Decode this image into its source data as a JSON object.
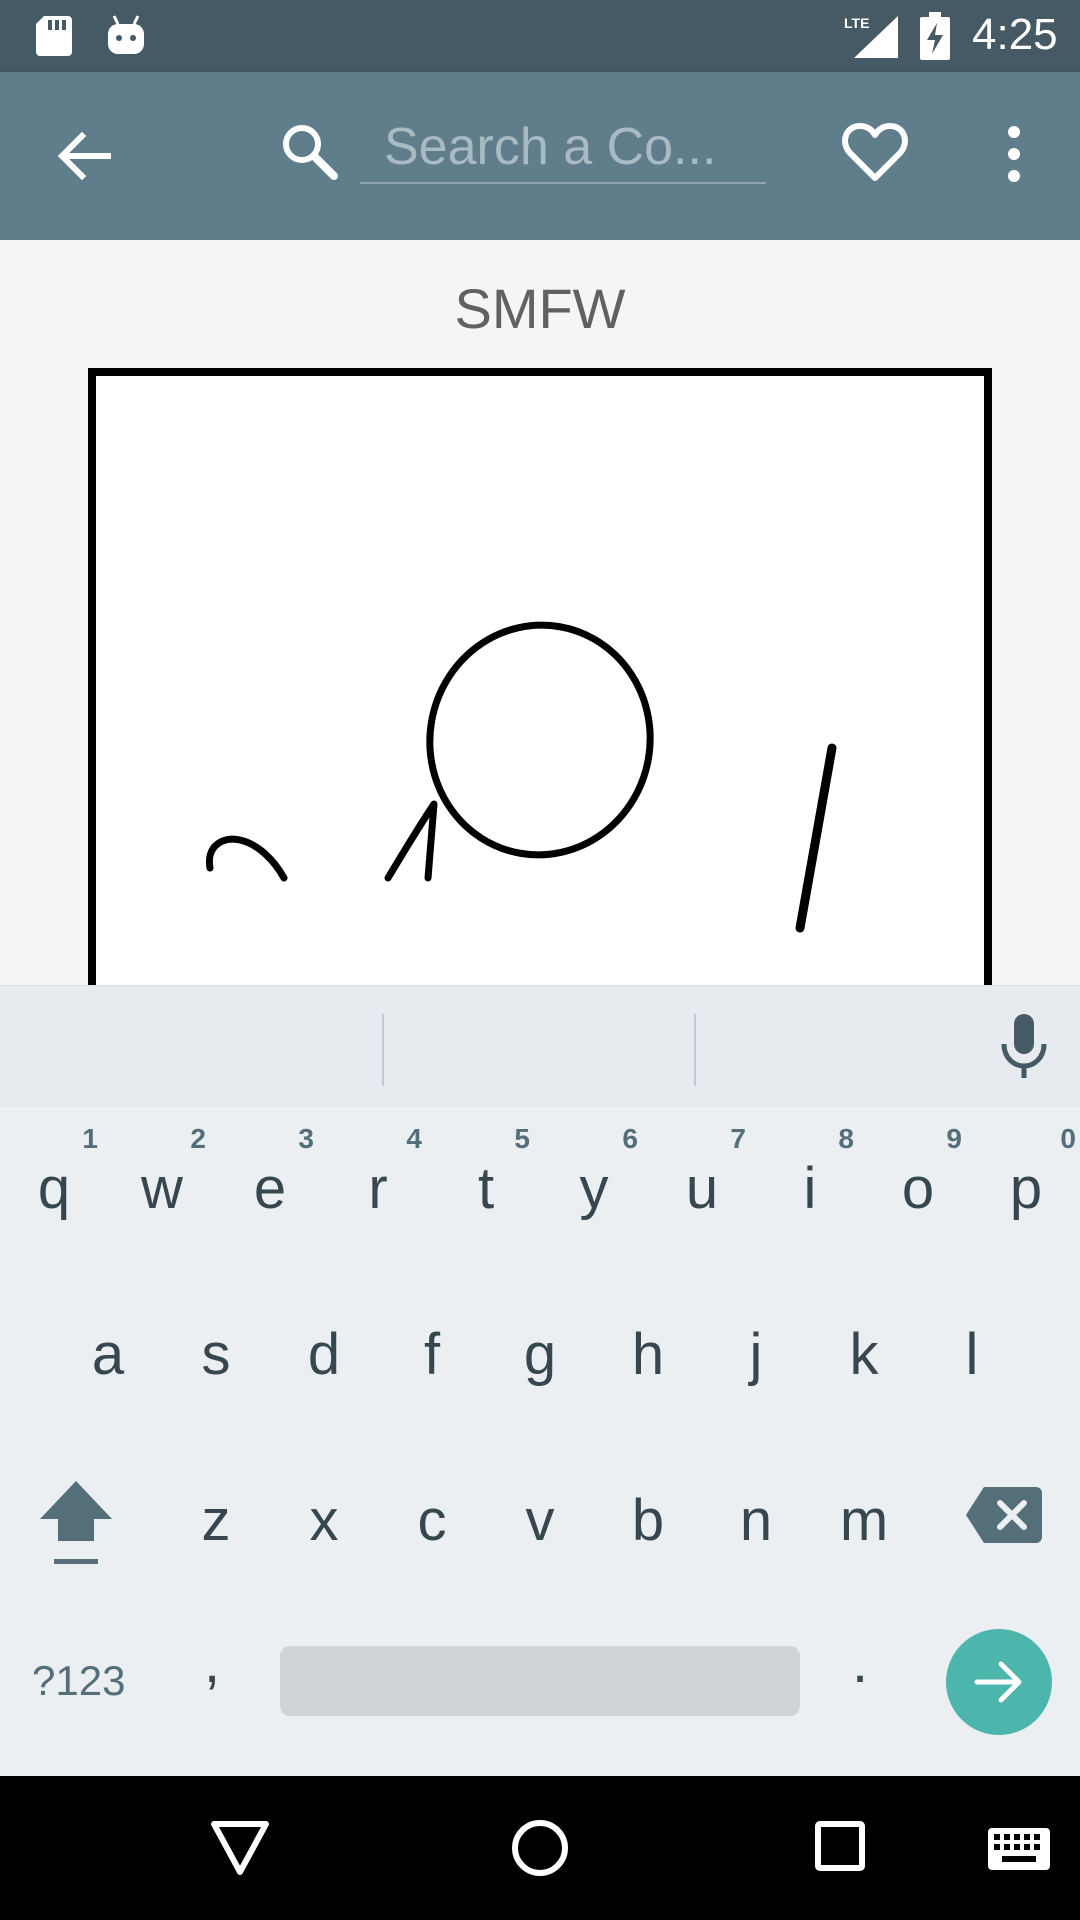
{
  "status_bar": {
    "time": "4:25",
    "network_label": "LTE",
    "icons": [
      "sd-card-icon",
      "android-debug-icon",
      "lte-signal-icon",
      "battery-charging-icon"
    ]
  },
  "toolbar": {
    "search_placeholder": "Search a Co...",
    "icons": [
      "back-arrow-icon",
      "search-icon",
      "heart-outline-icon",
      "more-vert-icon"
    ]
  },
  "comic": {
    "title": "SMFW"
  },
  "keyboard": {
    "row1": [
      {
        "letter": "q",
        "hint": "1"
      },
      {
        "letter": "w",
        "hint": "2"
      },
      {
        "letter": "e",
        "hint": "3"
      },
      {
        "letter": "r",
        "hint": "4"
      },
      {
        "letter": "t",
        "hint": "5"
      },
      {
        "letter": "y",
        "hint": "6"
      },
      {
        "letter": "u",
        "hint": "7"
      },
      {
        "letter": "i",
        "hint": "8"
      },
      {
        "letter": "o",
        "hint": "9"
      },
      {
        "letter": "p",
        "hint": "0"
      }
    ],
    "row2": [
      "a",
      "s",
      "d",
      "f",
      "g",
      "h",
      "j",
      "k",
      "l"
    ],
    "row3": [
      "z",
      "x",
      "c",
      "v",
      "b",
      "n",
      "m"
    ],
    "symbols_label": "?123",
    "comma_label": ",",
    "period_label": ".",
    "accent_color": "#4db6ac"
  },
  "colors": {
    "status_bar": "#455a64",
    "toolbar": "#607d8b",
    "keyboard_bg": "#eceff1"
  }
}
